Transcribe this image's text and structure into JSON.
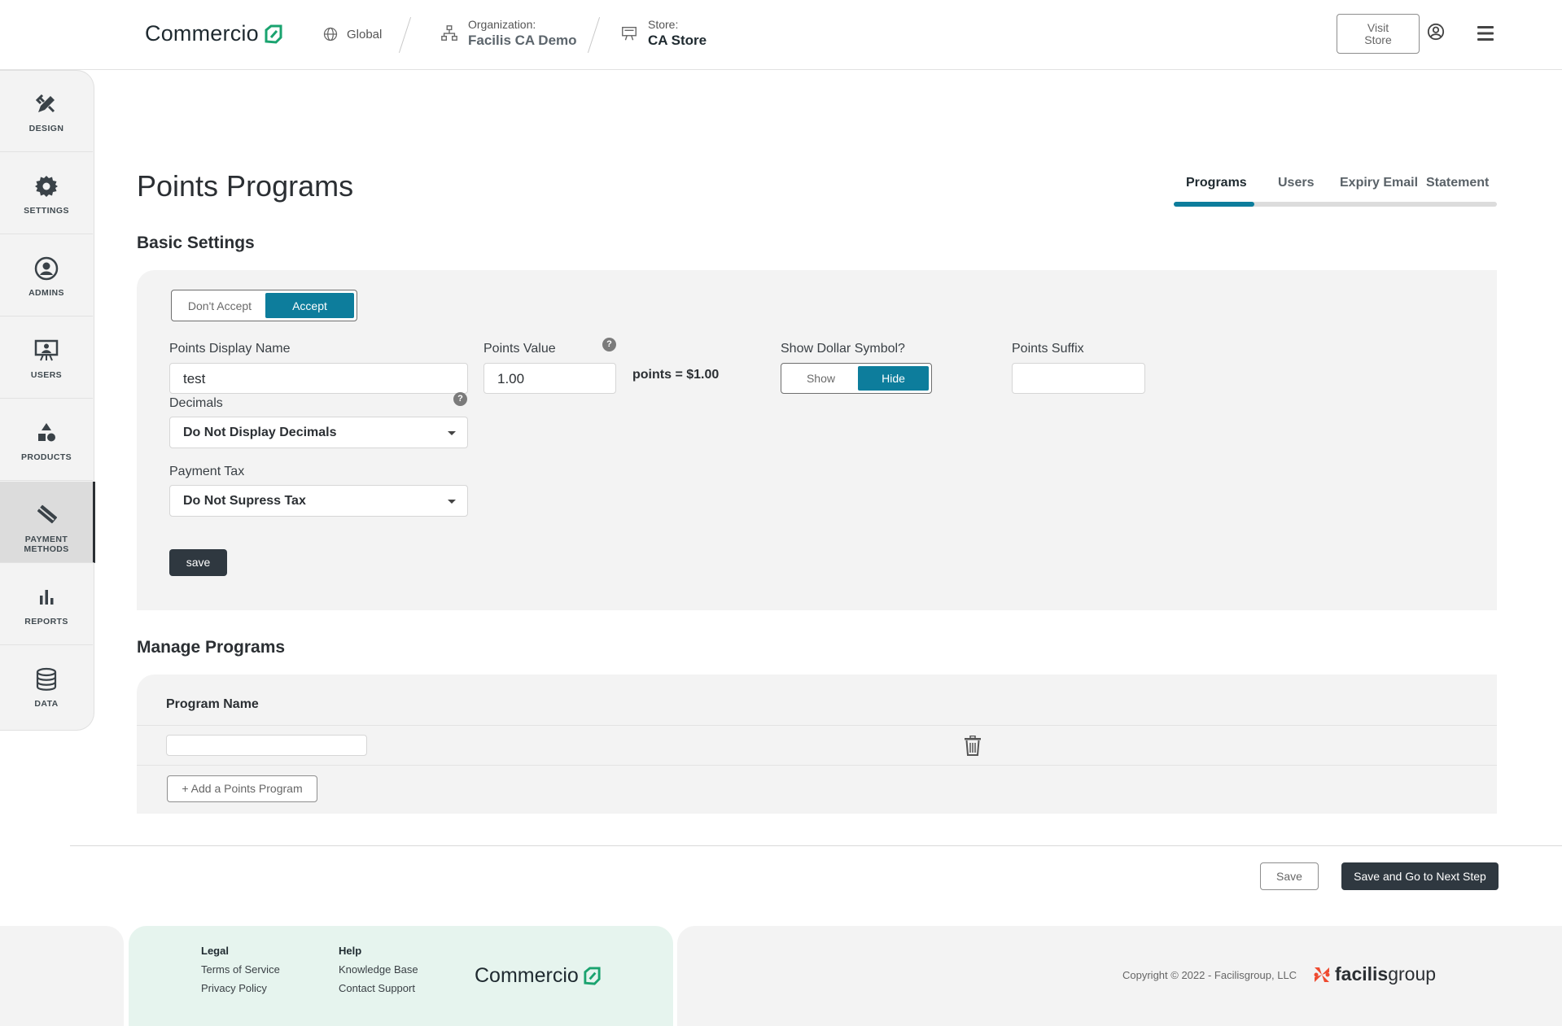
{
  "header": {
    "logo_text": "Commercio",
    "global_label": "Global",
    "organization_label": "Organization:",
    "organization_name": "Facilis CA Demo",
    "store_label": "Store:",
    "store_name": "CA Store",
    "visit_store_line1": "Visit",
    "visit_store_line2": "Store"
  },
  "sidebar": {
    "items": [
      {
        "label": "DESIGN",
        "icon": "design-icon"
      },
      {
        "label": "SETTINGS",
        "icon": "gear-icon"
      },
      {
        "label": "ADMINS",
        "icon": "admin-icon"
      },
      {
        "label": "USERS",
        "icon": "users-icon"
      },
      {
        "label": "PRODUCTS",
        "icon": "products-icon"
      },
      {
        "label_line1": "PAYMENT",
        "label_line2": "METHODS",
        "icon": "payment-icon",
        "active": true
      },
      {
        "label": "REPORTS",
        "icon": "reports-icon"
      },
      {
        "label": "DATA",
        "icon": "database-icon"
      }
    ]
  },
  "page": {
    "title": "Points Programs",
    "tabs": [
      {
        "label": "Programs",
        "active": true
      },
      {
        "label": "Users"
      },
      {
        "label": "Expiry Email"
      },
      {
        "label": "Statement"
      }
    ]
  },
  "basic_settings": {
    "heading": "Basic Settings",
    "accept_toggle": {
      "off_label": "Don't Accept",
      "on_label": "Accept",
      "selected": "Accept"
    },
    "display_name_label": "Points Display Name",
    "display_name_value": "test",
    "points_value_label": "Points Value",
    "points_value": "1.00",
    "points_equals": "points = $1.00",
    "dollar_symbol_label": "Show Dollar Symbol?",
    "dollar_toggle": {
      "show_label": "Show",
      "hide_label": "Hide",
      "selected": "Hide"
    },
    "suffix_label": "Points Suffix",
    "suffix_value": "",
    "decimals_label": "Decimals",
    "decimals_value": "Do Not Display Decimals",
    "payment_tax_label": "Payment Tax",
    "payment_tax_value": "Do Not Supress Tax",
    "help_glyph": "?",
    "save_label": "save"
  },
  "manage_programs": {
    "heading": "Manage Programs",
    "column_header": "Program Name",
    "rows": [
      {
        "name": ""
      }
    ],
    "add_label": "+ Add a Points Program"
  },
  "actions": {
    "save_label": "Save",
    "save_next_label": "Save and Go to Next Step"
  },
  "footer": {
    "legal_heading": "Legal",
    "terms": "Terms of Service",
    "privacy": "Privacy Policy",
    "help_heading": "Help",
    "knowledge_base": "Knowledge Base",
    "contact_support": "Contact Support",
    "logo_text": "Commercio",
    "copyright": "Copyright © 2022 - Facilisgroup, LLC",
    "brand_bold": "facilis",
    "brand_rest": "group"
  },
  "colors": {
    "accent": "#0d7d9c",
    "brand_green": "#1aa36f",
    "dark_button": "#2f3840",
    "facilis_orange": "#ef4b30"
  }
}
